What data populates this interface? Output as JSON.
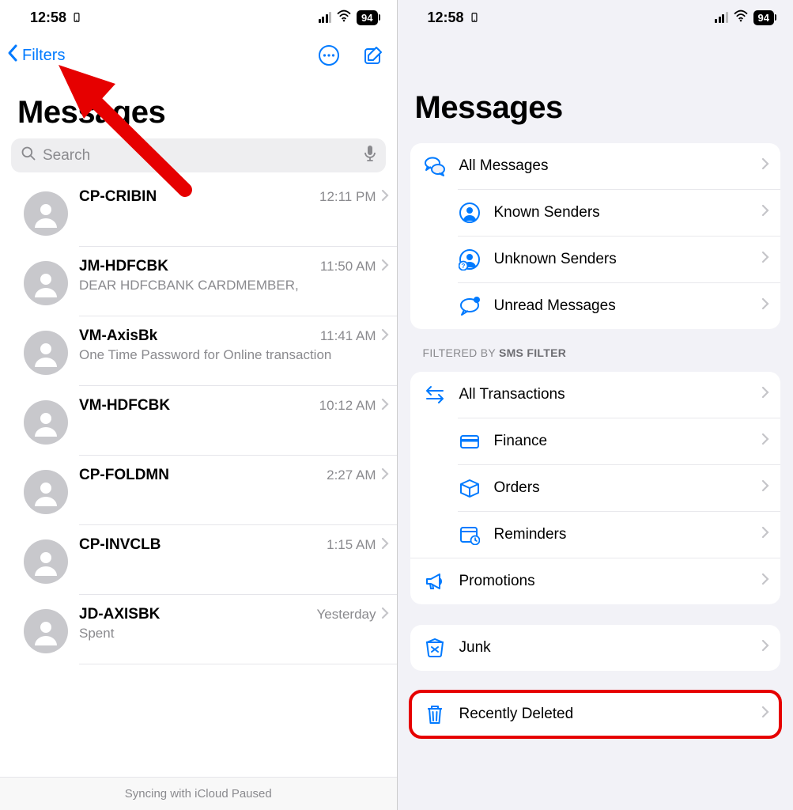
{
  "statusbar": {
    "time": "12:58",
    "battery": "94"
  },
  "left": {
    "nav": {
      "back_label": "Filters"
    },
    "title": "Messages",
    "search": {
      "placeholder": "Search"
    },
    "conversations": [
      {
        "name": "CP-CRIBIN",
        "time": "12:11 PM",
        "preview": ""
      },
      {
        "name": "JM-HDFCBK",
        "time": "11:50 AM",
        "preview": "DEAR HDFCBANK CARDMEMBER,"
      },
      {
        "name": "VM-AxisBk",
        "time": "11:41 AM",
        "preview": "One Time Password for Online transaction"
      },
      {
        "name": "VM-HDFCBK",
        "time": "10:12 AM",
        "preview": ""
      },
      {
        "name": "CP-FOLDMN",
        "time": "2:27 AM",
        "preview": ""
      },
      {
        "name": "CP-INVCLB",
        "time": "1:15 AM",
        "preview": ""
      },
      {
        "name": "JD-AXISBK",
        "time": "Yesterday",
        "preview": "Spent"
      }
    ],
    "footer": "Syncing with iCloud Paused"
  },
  "right": {
    "title": "Messages",
    "group1": [
      {
        "label": "All Messages"
      },
      {
        "label": "Known Senders"
      },
      {
        "label": "Unknown Senders"
      },
      {
        "label": "Unread Messages"
      }
    ],
    "section_label_prefix": "FILTERED BY ",
    "section_label_bold": "SMS FILTER",
    "group2_top": {
      "label": "All Transactions"
    },
    "group2_sub": [
      {
        "label": "Finance"
      },
      {
        "label": "Orders"
      },
      {
        "label": "Reminders"
      }
    ],
    "group2_bottom": {
      "label": "Promotions"
    },
    "group3": {
      "label": "Junk"
    },
    "group4": {
      "label": "Recently Deleted"
    }
  }
}
